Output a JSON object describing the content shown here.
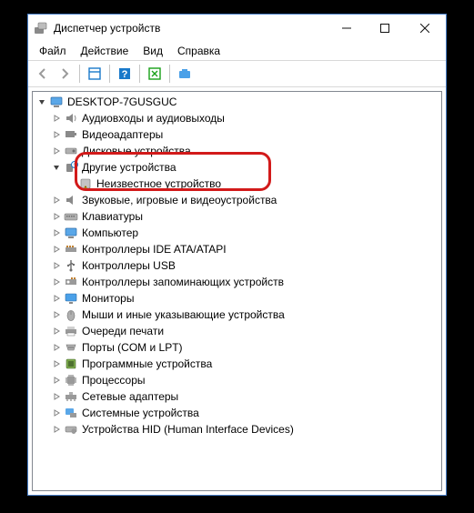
{
  "window": {
    "title": "Диспетчер устройств"
  },
  "menu": {
    "file": "Файл",
    "action": "Действие",
    "view": "Вид",
    "help": "Справка"
  },
  "tree": {
    "root": "DESKTOP-7GUSGUC",
    "audio": "Аудиовходы и аудиовыходы",
    "video": "Видеоадаптеры",
    "disks": "Дисковые устройства",
    "other": "Другие устройства",
    "unknown": "Неизвестное устройство",
    "sound_game": "Звуковые, игровые и видеоустройства",
    "keyboards": "Клавиатуры",
    "computer": "Компьютер",
    "ide": "Контроллеры IDE ATA/ATAPI",
    "usb": "Контроллеры USB",
    "storage_ctrl": "Контроллеры запоминающих устройств",
    "monitors": "Мониторы",
    "mice": "Мыши и иные указывающие устройства",
    "print_queues": "Очереди печати",
    "ports": "Порты (COM и LPT)",
    "software_dev": "Программные устройства",
    "processors": "Процессоры",
    "net_adapters": "Сетевые адаптеры",
    "system_dev": "Системные устройства",
    "hid": "Устройства HID (Human Interface Devices)"
  }
}
